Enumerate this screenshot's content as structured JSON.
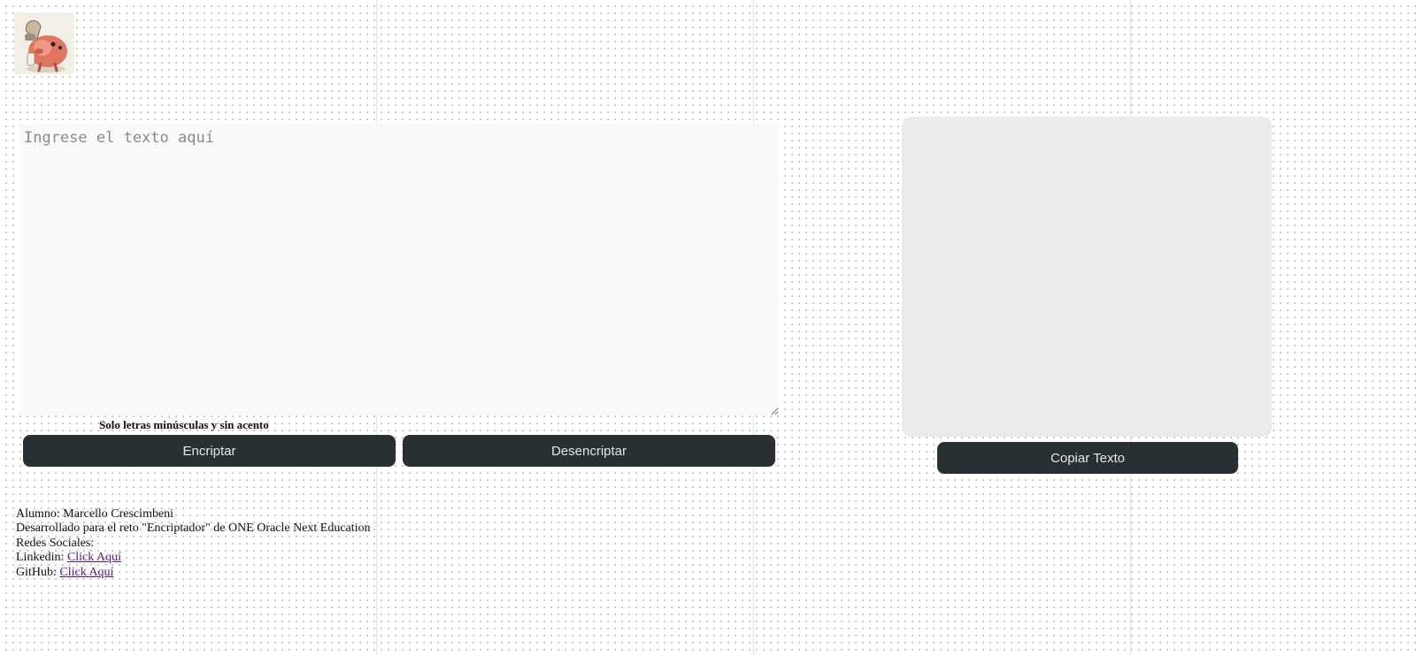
{
  "logo": {
    "icon": "pig-mascot-icon"
  },
  "input": {
    "placeholder": "Ingrese el texto aquí",
    "value": ""
  },
  "hint": "Solo letras minúsculas y sin acento",
  "buttons": {
    "encrypt": "Encriptar",
    "decrypt": "Desencriptar",
    "copy": "Copiar Texto"
  },
  "output": {
    "text": ""
  },
  "footer": {
    "student": "Alumno: Marcello Crescimbeni",
    "developed": "Desarrollado para el reto \"Encriptador\" de ONE Oracle Next Education",
    "social_title": "Redes Sociales:",
    "linkedin_label": "Linkedin:",
    "linkedin_link": "Click Aquí",
    "github_label": "GitHub:",
    "github_link": "Click Aquí"
  },
  "colors": {
    "button_bg": "#283033",
    "button_text": "#e6e6e6",
    "output_bg": "#eceaea",
    "link": "#551a8b"
  }
}
